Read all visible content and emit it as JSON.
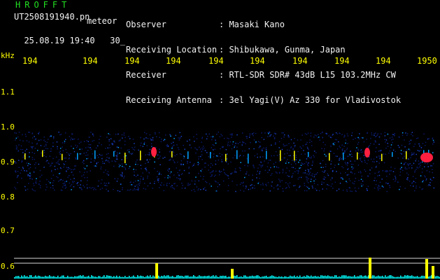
{
  "header": {
    "logo": "HROFFT",
    "filename": "UT2508191940.pn",
    "filename_suffix": "meteor",
    "datetime": "25.08.19 19:40",
    "interval": "30_"
  },
  "metadata": [
    {
      "label": "Observer",
      "value": "Masaki Kano"
    },
    {
      "label": "Receiving Location",
      "value": "Shibukawa, Gunma, Japan"
    },
    {
      "label": "Receiver",
      "value": "RTL-SDR SDR# 43dB L15 103.2MHz CW"
    },
    {
      "label": "Receiving Antenna",
      "value": "3el Yagi(V) Az 330 for Vladivostok"
    }
  ],
  "axes": {
    "y_unit": "kHz",
    "y_labels": [
      "1.1",
      "1.0",
      "0.9",
      "0.8",
      "0.7",
      "0.6"
    ],
    "x_labels": [
      "194",
      "194",
      "194",
      "194",
      "194",
      "194",
      "194",
      "194",
      "194",
      "1950"
    ]
  },
  "colors": {
    "text_header": "#f2f2f2",
    "logo": "#22e022",
    "axis": "#ffff00",
    "background": "#000000",
    "signal_strong": "#ff2040",
    "signal_mid": "#ffff00",
    "signal_low": "#00a0ff",
    "bottom_bars": "#00ffff"
  }
}
